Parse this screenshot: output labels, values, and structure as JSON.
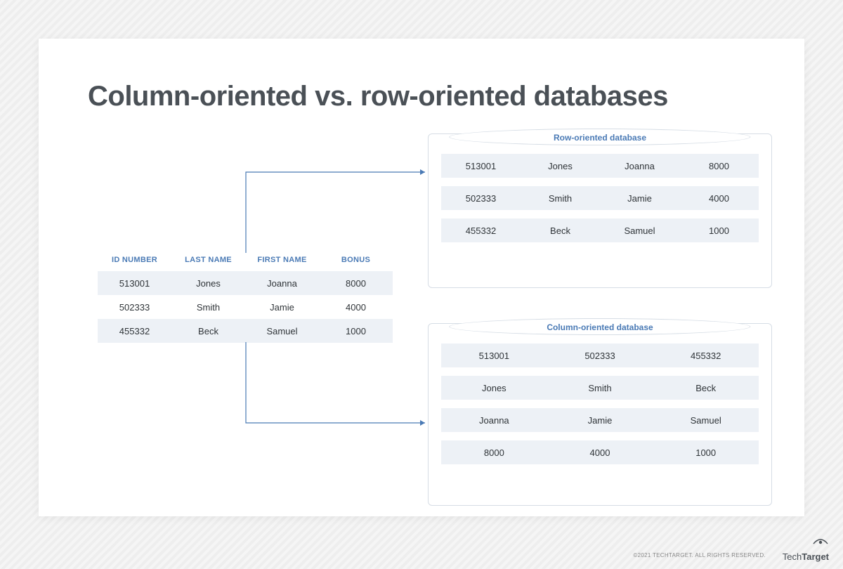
{
  "title": "Column-oriented vs. row-oriented databases",
  "source_table": {
    "headers": [
      "ID NUMBER",
      "LAST NAME",
      "FIRST NAME",
      "BONUS"
    ],
    "rows": [
      [
        "513001",
        "Jones",
        "Joanna",
        "8000"
      ],
      [
        "502333",
        "Smith",
        "Jamie",
        "4000"
      ],
      [
        "455332",
        "Beck",
        "Samuel",
        "1000"
      ]
    ]
  },
  "row_db": {
    "label": "Row-oriented database",
    "rows": [
      [
        "513001",
        "Jones",
        "Joanna",
        "8000"
      ],
      [
        "502333",
        "Smith",
        "Jamie",
        "4000"
      ],
      [
        "455332",
        "Beck",
        "Samuel",
        "1000"
      ]
    ]
  },
  "col_db": {
    "label": "Column-oriented database",
    "rows": [
      [
        "513001",
        "502333",
        "455332"
      ],
      [
        "Jones",
        "Smith",
        "Beck"
      ],
      [
        "Joanna",
        "Jamie",
        "Samuel"
      ],
      [
        "8000",
        "4000",
        "1000"
      ]
    ]
  },
  "footer": {
    "copyright": "©2021 TECHTARGET. ALL RIGHTS RESERVED.",
    "logo_light": "Tech",
    "logo_bold": "Target"
  }
}
